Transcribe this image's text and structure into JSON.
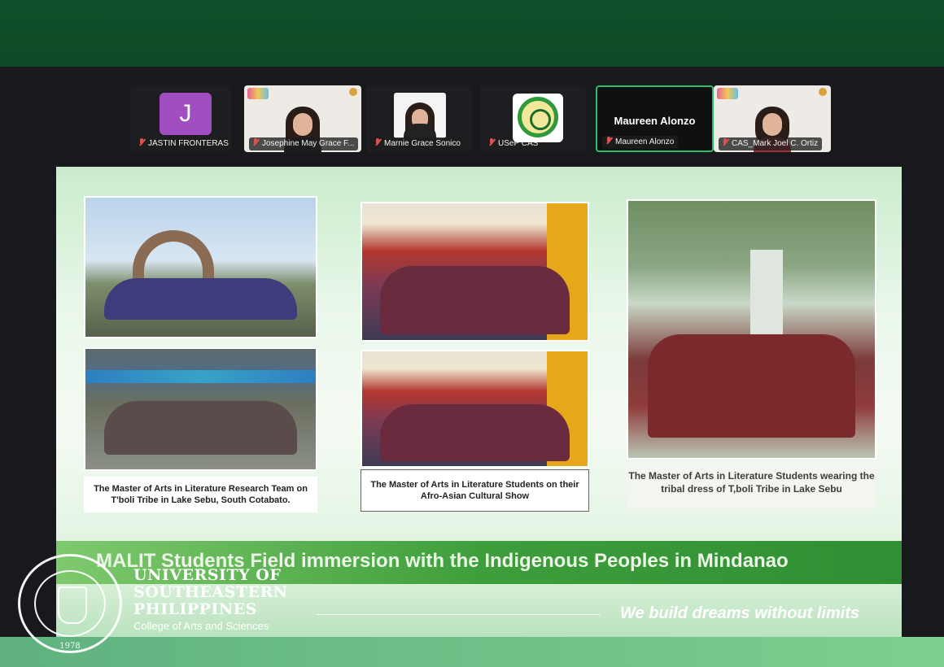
{
  "participants": [
    {
      "name": "JASTIN FRONTERAS",
      "avatar_letter": "J",
      "muted": true
    },
    {
      "name": "Josephine May Grace F...",
      "muted": true
    },
    {
      "name": "Marnie Grace Sonico",
      "muted": true
    },
    {
      "name": "USeP CAS",
      "muted": true
    },
    {
      "name": "Maureen Alonzo",
      "display_name": "Maureen Alonzo",
      "muted": true,
      "active_speaker": true
    },
    {
      "name": "CAS_Mark Joel C. Ortiz",
      "muted": true
    }
  ],
  "slide": {
    "captions": [
      "The Master of Arts in Literature Research Team on T'boli Tribe in Lake Sebu, South Cotabato.",
      "The Master of Arts in Literature Students on their Afro-Asian Cultural Show",
      "The Master of Arts in Literature Students wearing the tribal dress of T,boli Tribe in Lake Sebu"
    ],
    "banner": "MALIT Students Field immersion with the Indigenous Peoples in Mindanao"
  },
  "branding": {
    "university_line1": "UNIVERSITY OF",
    "university_line2": "SOUTHEASTERN",
    "university_line3": "PHILIPPINES",
    "college": "College of Arts and Sciences",
    "seal_year": "1978",
    "tagline": "We build dreams without limits"
  },
  "colors": {
    "accent_green": "#2ebd6b",
    "top_band": "#0f4f2a",
    "muted_icon": "#e05252",
    "avatar_purple": "#a14ec0"
  }
}
